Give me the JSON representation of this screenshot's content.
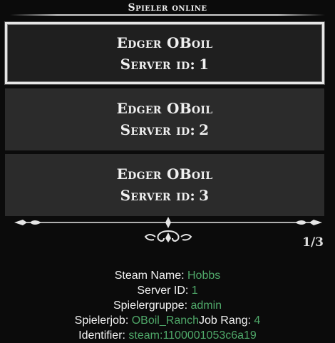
{
  "header": {
    "title": "Spieler online"
  },
  "players": [
    {
      "name": "Edger OBoil",
      "id_label": "Server id:",
      "id": "1",
      "selected": true
    },
    {
      "name": "Edger OBoil",
      "id_label": "Server id:",
      "id": "2",
      "selected": false
    },
    {
      "name": "Edger OBoil",
      "id_label": "Server id:",
      "id": "3",
      "selected": false
    }
  ],
  "pagination": {
    "text": "1/3"
  },
  "details": {
    "steam_name_label": "Steam Name:",
    "steam_name": "Hobbs",
    "server_id_label": "Server ID:",
    "server_id": "1",
    "group_label": "Spielergruppe:",
    "group": "admin",
    "job_label": "Spielerjob:",
    "job": "OBoil_Ranch",
    "job_rank_label": "Job Rang:",
    "job_rank": "4",
    "identifier_label": "Identifier:",
    "identifier": "steam:1100001053c6a19"
  },
  "colors": {
    "accent_green": "#4fa869",
    "card_bg": "#2b2b2b",
    "selected_border": "#e6e6e6"
  },
  "icons": {
    "divider": "ornamental-divider-icon"
  }
}
